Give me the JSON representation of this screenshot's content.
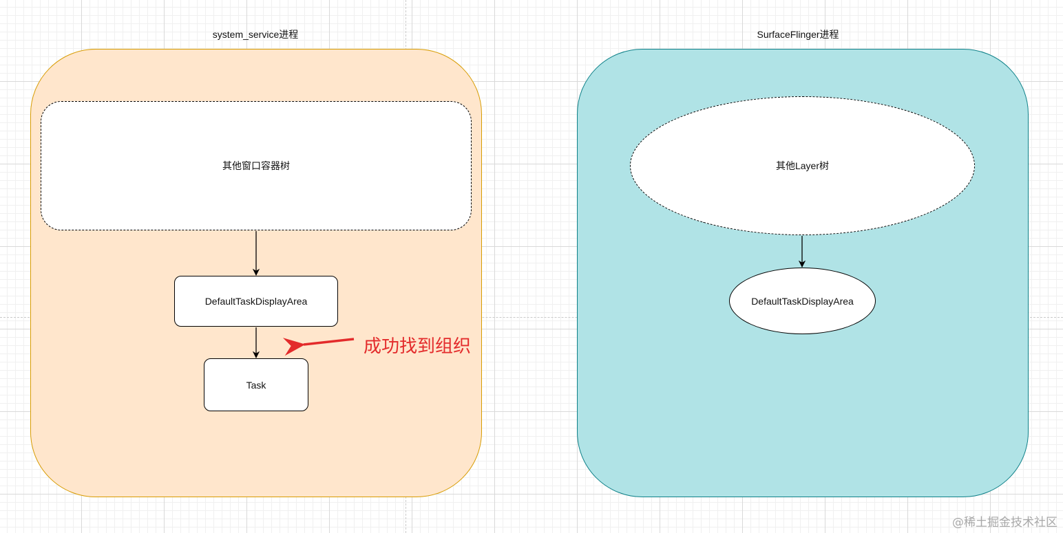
{
  "diagram": {
    "left_process": {
      "title": "system_service进程",
      "tree_label": "其他窗口容器树",
      "display_area_label": "DefaultTaskDisplayArea",
      "task_label": "Task",
      "fill_color": "#ffe6cc",
      "stroke_color": "#d79b00"
    },
    "right_process": {
      "title": "SurfaceFlinger进程",
      "tree_label": "其他Layer树",
      "display_area_label": "DefaultTaskDisplayArea",
      "fill_color": "#b0e3e6",
      "stroke_color": "#0e8088"
    },
    "callout": {
      "text": "成功找到组织",
      "color": "#e32b2b"
    },
    "watermark": "@稀土掘金技术社区"
  }
}
